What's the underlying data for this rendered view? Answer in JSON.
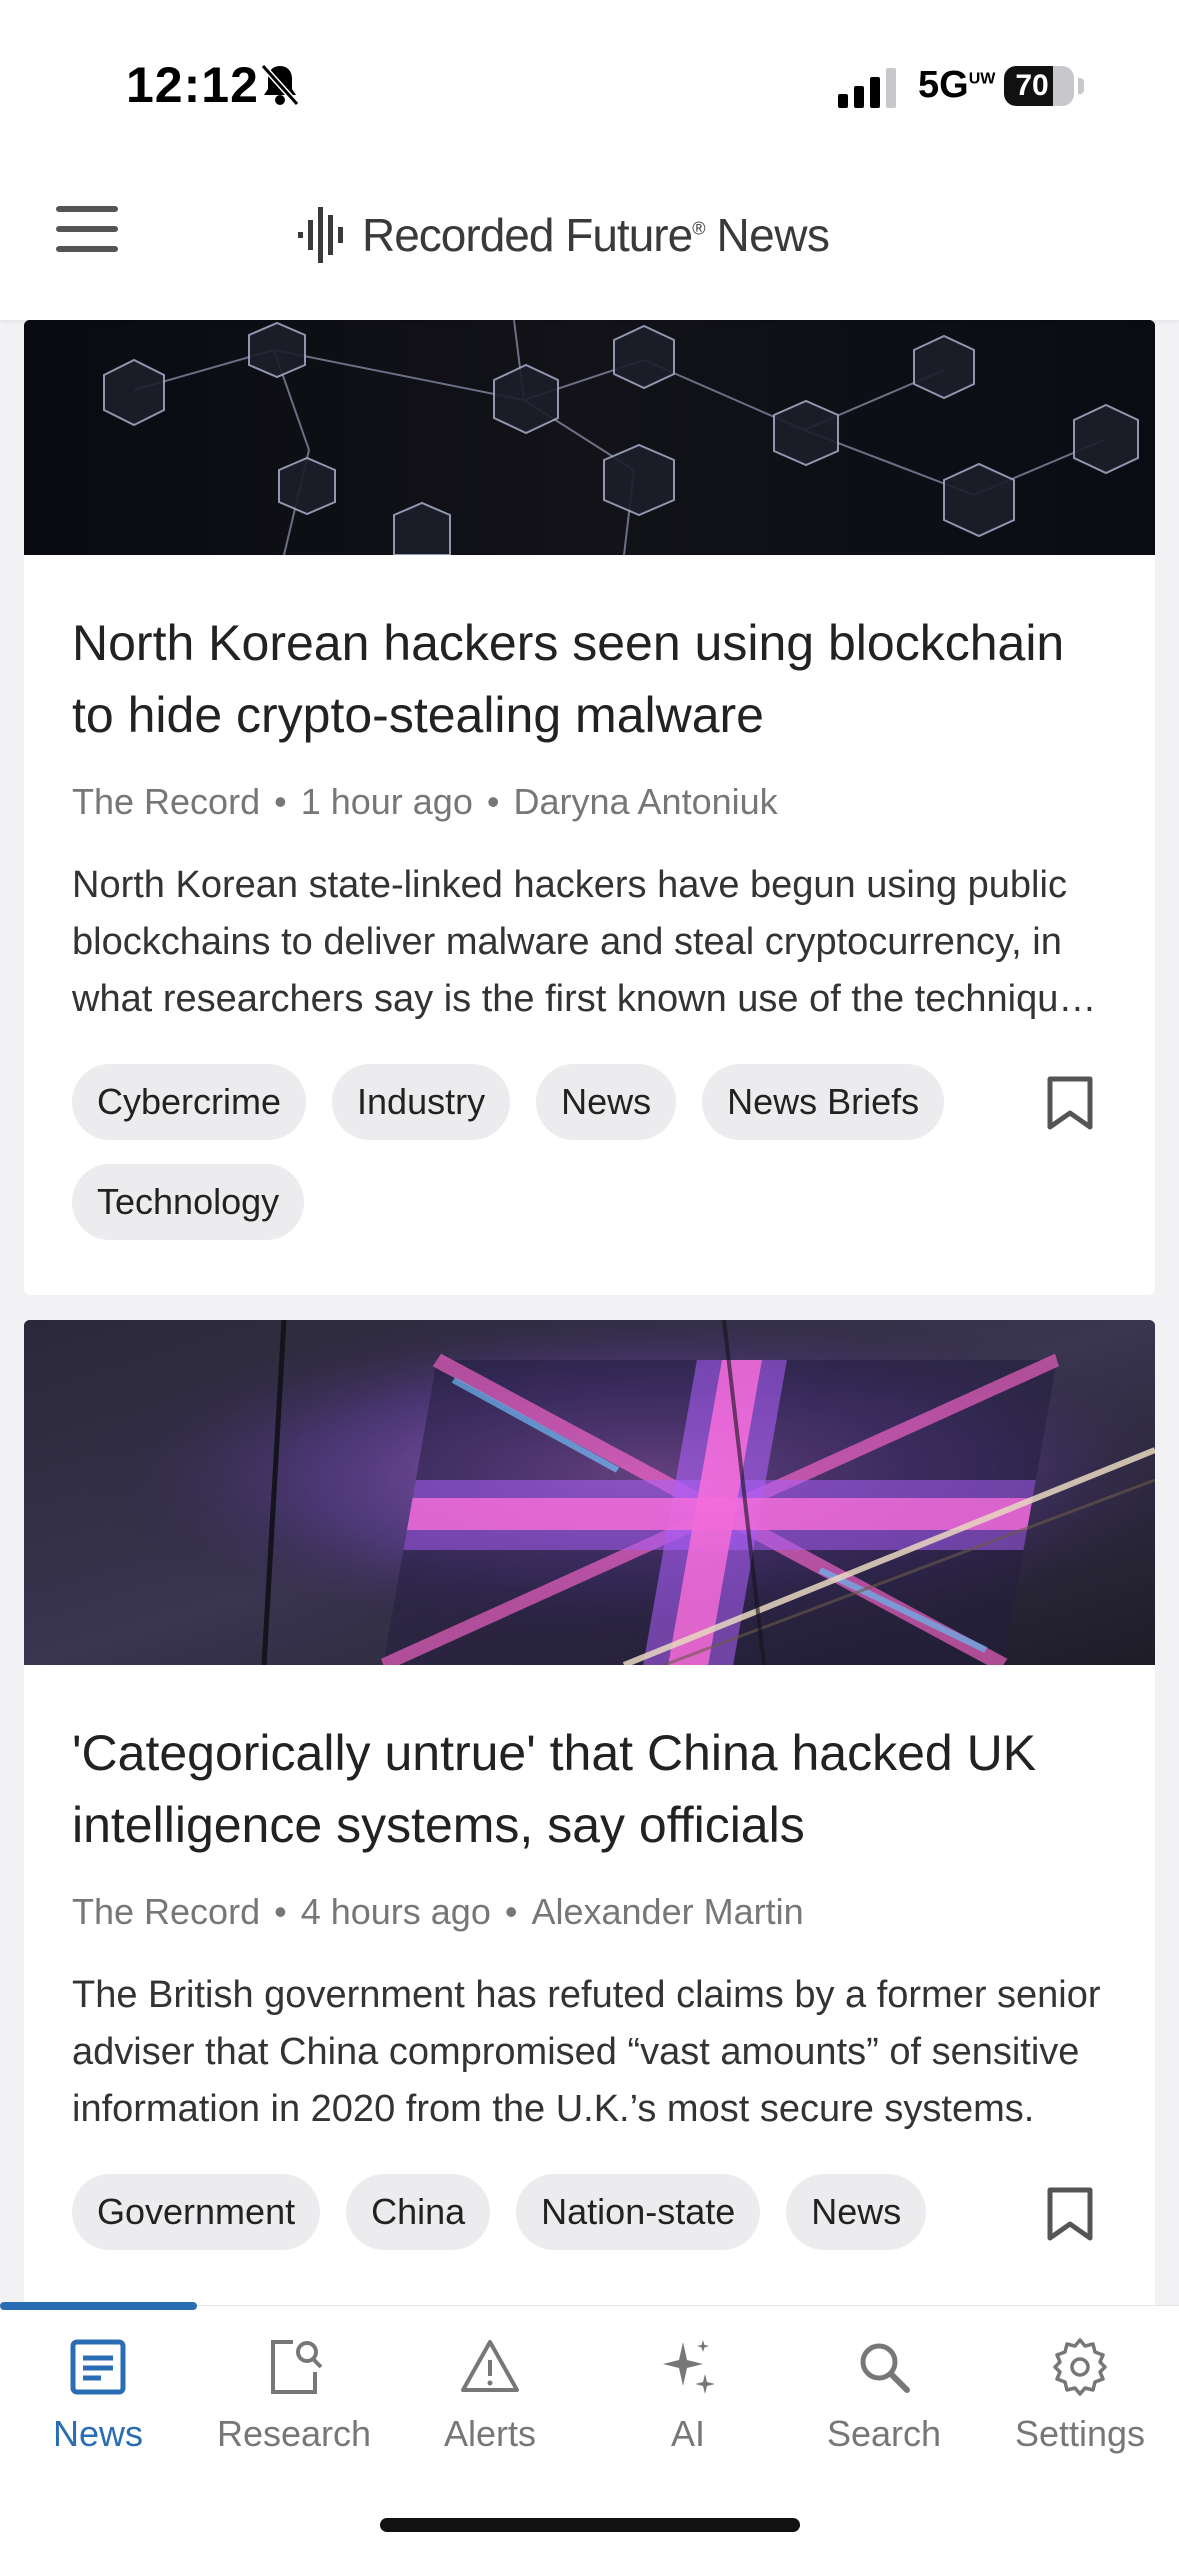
{
  "status": {
    "time": "12:12",
    "network": "5G",
    "network_suffix": "UW",
    "battery": "70",
    "battery_level": 0.7
  },
  "header": {
    "brand": "Recorded Future",
    "brand_mark": "®",
    "section": "News"
  },
  "articles": [
    {
      "title": "North Korean hackers seen using blockchain to hide crypto-stealing malware",
      "source": "The Record",
      "time": "1 hour ago",
      "author": "Daryna Antoniuk",
      "summary": "North Korean state-linked hackers have begun using public blockchains to deliver malware and steal cryptocurrency, in what researchers say is the first known use of the technique by a nation-state actor.",
      "tags": [
        "Cybercrime",
        "Industry",
        "News",
        "News Briefs",
        "Technology"
      ]
    },
    {
      "title": "'Categorically untrue' that China hacked UK intelligence systems, say officials",
      "source": "The Record",
      "time": "4 hours ago",
      "author": "Alexander Martin",
      "summary": "The British government has refuted claims by a former senior adviser that China compromised “vast amounts” of sensitive information in 2020 from the U.K.’s most secure systems.",
      "tags": [
        "Government",
        "China",
        "Nation-state",
        "News"
      ]
    }
  ],
  "nav": {
    "items": [
      {
        "label": "News",
        "icon": "news-icon"
      },
      {
        "label": "Research",
        "icon": "research-icon"
      },
      {
        "label": "Alerts",
        "icon": "alert-icon"
      },
      {
        "label": "AI",
        "icon": "sparkle-icon"
      },
      {
        "label": "Search",
        "icon": "search-icon"
      },
      {
        "label": "Settings",
        "icon": "gear-icon"
      }
    ],
    "active": "News"
  },
  "colors": {
    "accent": "#2a6db5",
    "nav_inactive": "#777777",
    "tag_bg": "#ececee"
  }
}
